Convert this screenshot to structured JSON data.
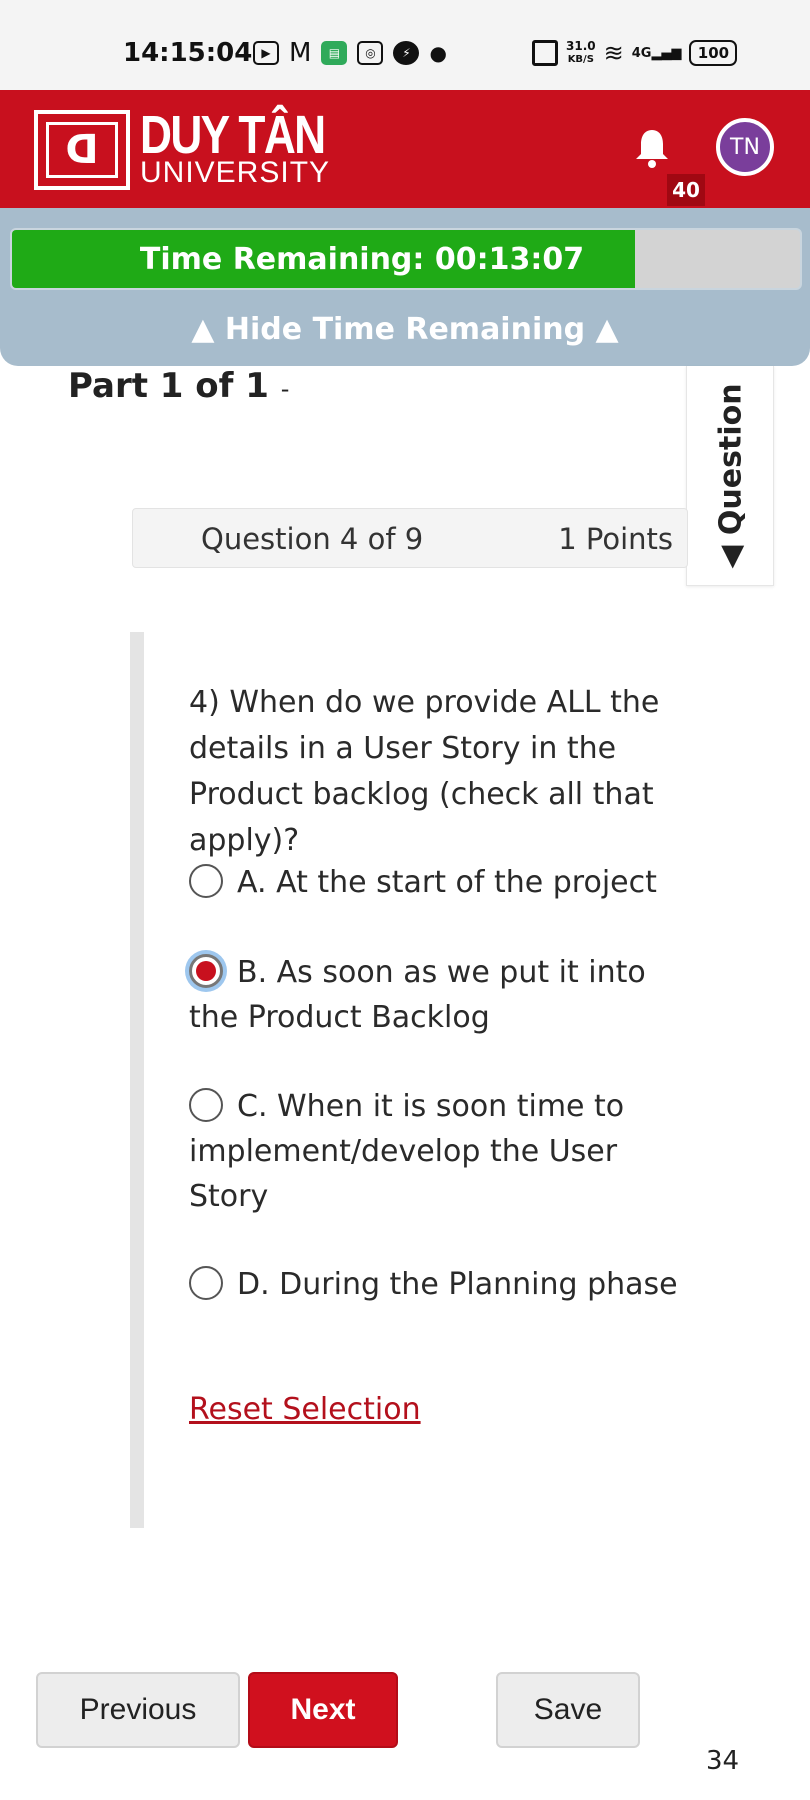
{
  "status_bar": {
    "time": "14:15:04",
    "notification_icons": [
      "video-call-icon",
      "gmail-icon",
      "app-icon",
      "instagram-icon",
      "messenger-icon",
      "dot-icon"
    ],
    "network_speed": "31.0",
    "network_speed_unit": "KB/S",
    "signal_label": "4G",
    "battery": "100"
  },
  "header": {
    "logo_mark": "ꓷ",
    "logo_title": "DUY TÂN",
    "logo_subtitle": "UNIVERSITY",
    "notification_count": "40",
    "avatar_initials": "TN"
  },
  "timer": {
    "label": "Time Remaining: 00:13:07",
    "remaining_fraction": 0.79,
    "hide_label": "▲ Hide Time Remaining ▲"
  },
  "part": {
    "title": "Part 1 of 1",
    "suffix": "-"
  },
  "side_tab": {
    "label": "◀ Question"
  },
  "question": {
    "counter": "Question 4 of 9",
    "points": "1 Points",
    "text": "4) When do we provide ALL the details in a User Story in the Product backlog (check all that apply)?",
    "options": [
      {
        "text": "A. At the start of the project",
        "selected": false
      },
      {
        "text": "B. As soon as we put it into the Product Backlog",
        "selected": true
      },
      {
        "text": "C. When it is soon time to implement/develop the User Story",
        "selected": false
      },
      {
        "text": "D. During the Planning phase",
        "selected": false
      }
    ],
    "reset_label": "Reset Selection"
  },
  "nav": {
    "previous_label": "Previous",
    "next_label": "Next",
    "save_label": "Save"
  },
  "page_number": "34",
  "colors": {
    "brand_red": "#c8101e",
    "timer_green": "#1faa16",
    "timer_panel": "#a7bccc"
  }
}
